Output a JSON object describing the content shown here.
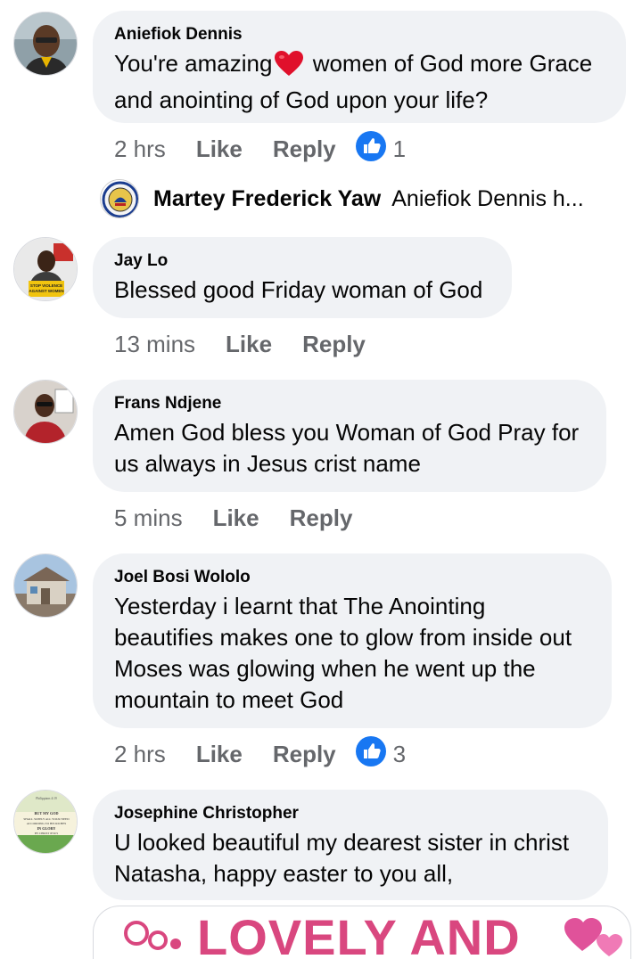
{
  "comments": [
    {
      "author": "Aniefiok Dennis",
      "text_before": "You're amazing",
      "text_after": " women of God more Grace and anointing of God upon your life?",
      "time": "2 hrs",
      "like": "Like",
      "reply": "Reply",
      "reaction_count": "1"
    },
    {
      "author": "Jay Lo",
      "text": "Blessed good Friday woman of God",
      "time": "13 mins",
      "like": "Like",
      "reply": "Reply"
    },
    {
      "author": "Frans Ndjene",
      "text": "Amen God bless you Woman of God Pray for us always in Jesus crist name",
      "time": "5 mins",
      "like": "Like",
      "reply": "Reply"
    },
    {
      "author": "Joel Bosi Wololo",
      "text": "Yesterday i learnt that The Anointing beautifies makes one to glow from inside out Moses was glowing when he went up the mountain to meet God",
      "time": "2 hrs",
      "like": "Like",
      "reply": "Reply",
      "reaction_count": "3"
    },
    {
      "author": "Josephine Christopher",
      "text": "U looked beautiful my dearest sister in christ Natasha, happy easter to you all,"
    }
  ],
  "reply_preview": {
    "author": "Martey Frederick Yaw",
    "text": "Aniefiok Dennis h..."
  },
  "avatar_texts": {
    "jay_lo": "STOP VIOLENCE AGAINST WOMEN",
    "josephine": "BUT MY GOD SHALL SUPPLY ALL YOUR NEED ACCORDING TO HIS RICHES IN GLORY BY CHRIST JESUS",
    "josephine_ref": "Philippians 4:19"
  },
  "image_preview_text": "LOVELY AND",
  "colors": {
    "bubble": "#f0f2f5",
    "meta": "#65676b",
    "like_blue": "#1877f2",
    "heart_red": "#e0102b",
    "peek_pink": "#d9477f"
  },
  "icons": {
    "reaction": "thumbs-up-icon",
    "inline_emoji": "red-heart-icon"
  }
}
